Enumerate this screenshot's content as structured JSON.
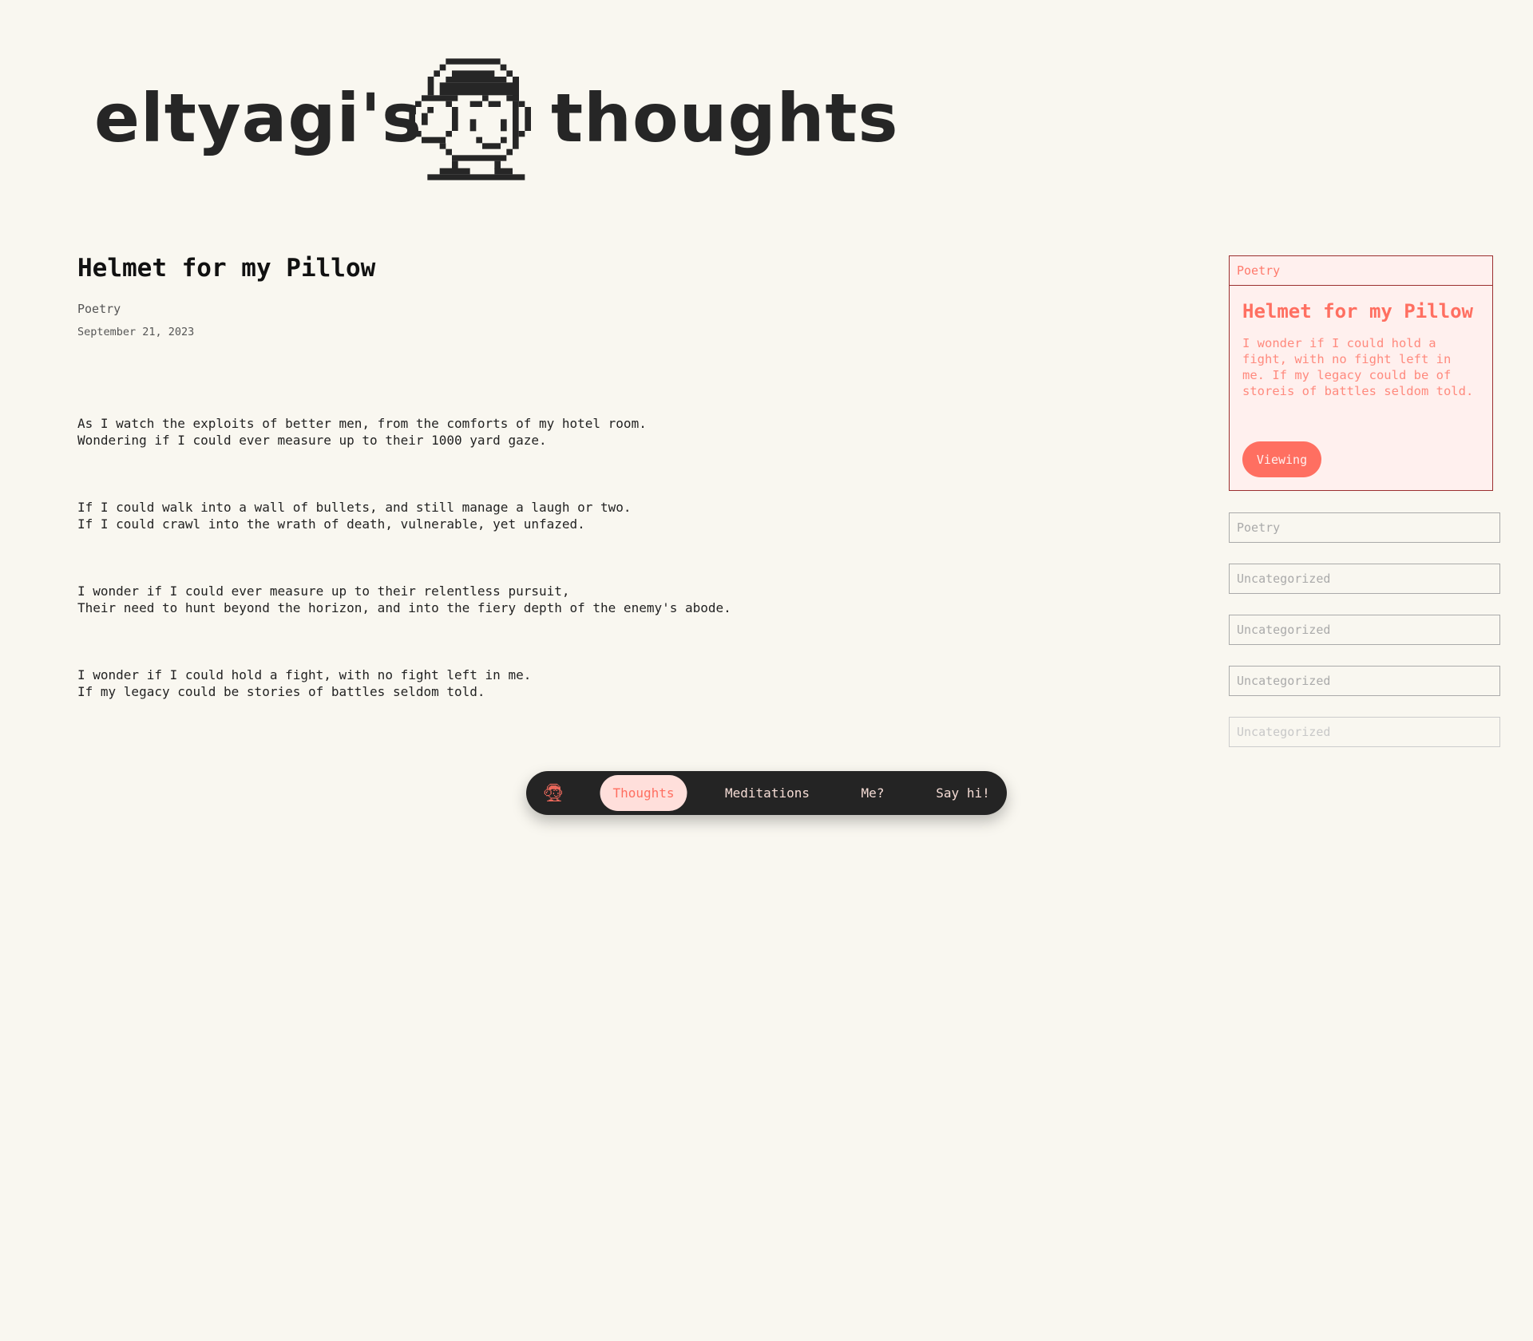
{
  "header": {
    "name": "eltyagi's",
    "suffix": "thoughts"
  },
  "post": {
    "title": "Helmet for my Pillow",
    "category": "Poetry",
    "date": "September 21, 2023",
    "stanzas": [
      [
        "As I watch the exploits of better men, from the comforts of my hotel room.",
        "Wondering if I could ever measure up to their 1000 yard gaze."
      ],
      [
        "If I could walk into a wall of bullets, and still manage a laugh or two.",
        "If I could crawl into the wrath of death, vulnerable, yet unfazed."
      ],
      [
        "I wonder if I could ever measure up to their relentless pursuit,",
        "Their need to hunt beyond the horizon, and into the fiery depth of the enemy's abode."
      ],
      [
        "I wonder if I could hold a fight, with no fight left in me.",
        "If my legacy could be stories of battles seldom told."
      ]
    ]
  },
  "sidebar": {
    "active_card": {
      "category": "Poetry",
      "title": "Helmet for my Pillow",
      "excerpt": "I wonder if I could hold a fight, with no fight left in me. If my legacy could be of storeis of battles seldom told.",
      "button": "Viewing"
    },
    "items": [
      {
        "category": "Poetry"
      },
      {
        "category": "Uncategorized"
      },
      {
        "category": "Uncategorized"
      },
      {
        "category": "Uncategorized"
      },
      {
        "category": "Uncategorized"
      }
    ]
  },
  "nav": {
    "items": [
      {
        "label": "Thoughts",
        "active": true
      },
      {
        "label": "Meditations"
      },
      {
        "label": "Me?"
      },
      {
        "label": "Say hi!"
      }
    ]
  },
  "colors": {
    "background": "#f9f7f0",
    "accent": "#ff6f61",
    "nav_bg": "#242424",
    "card_border": "#9b2f2f"
  }
}
